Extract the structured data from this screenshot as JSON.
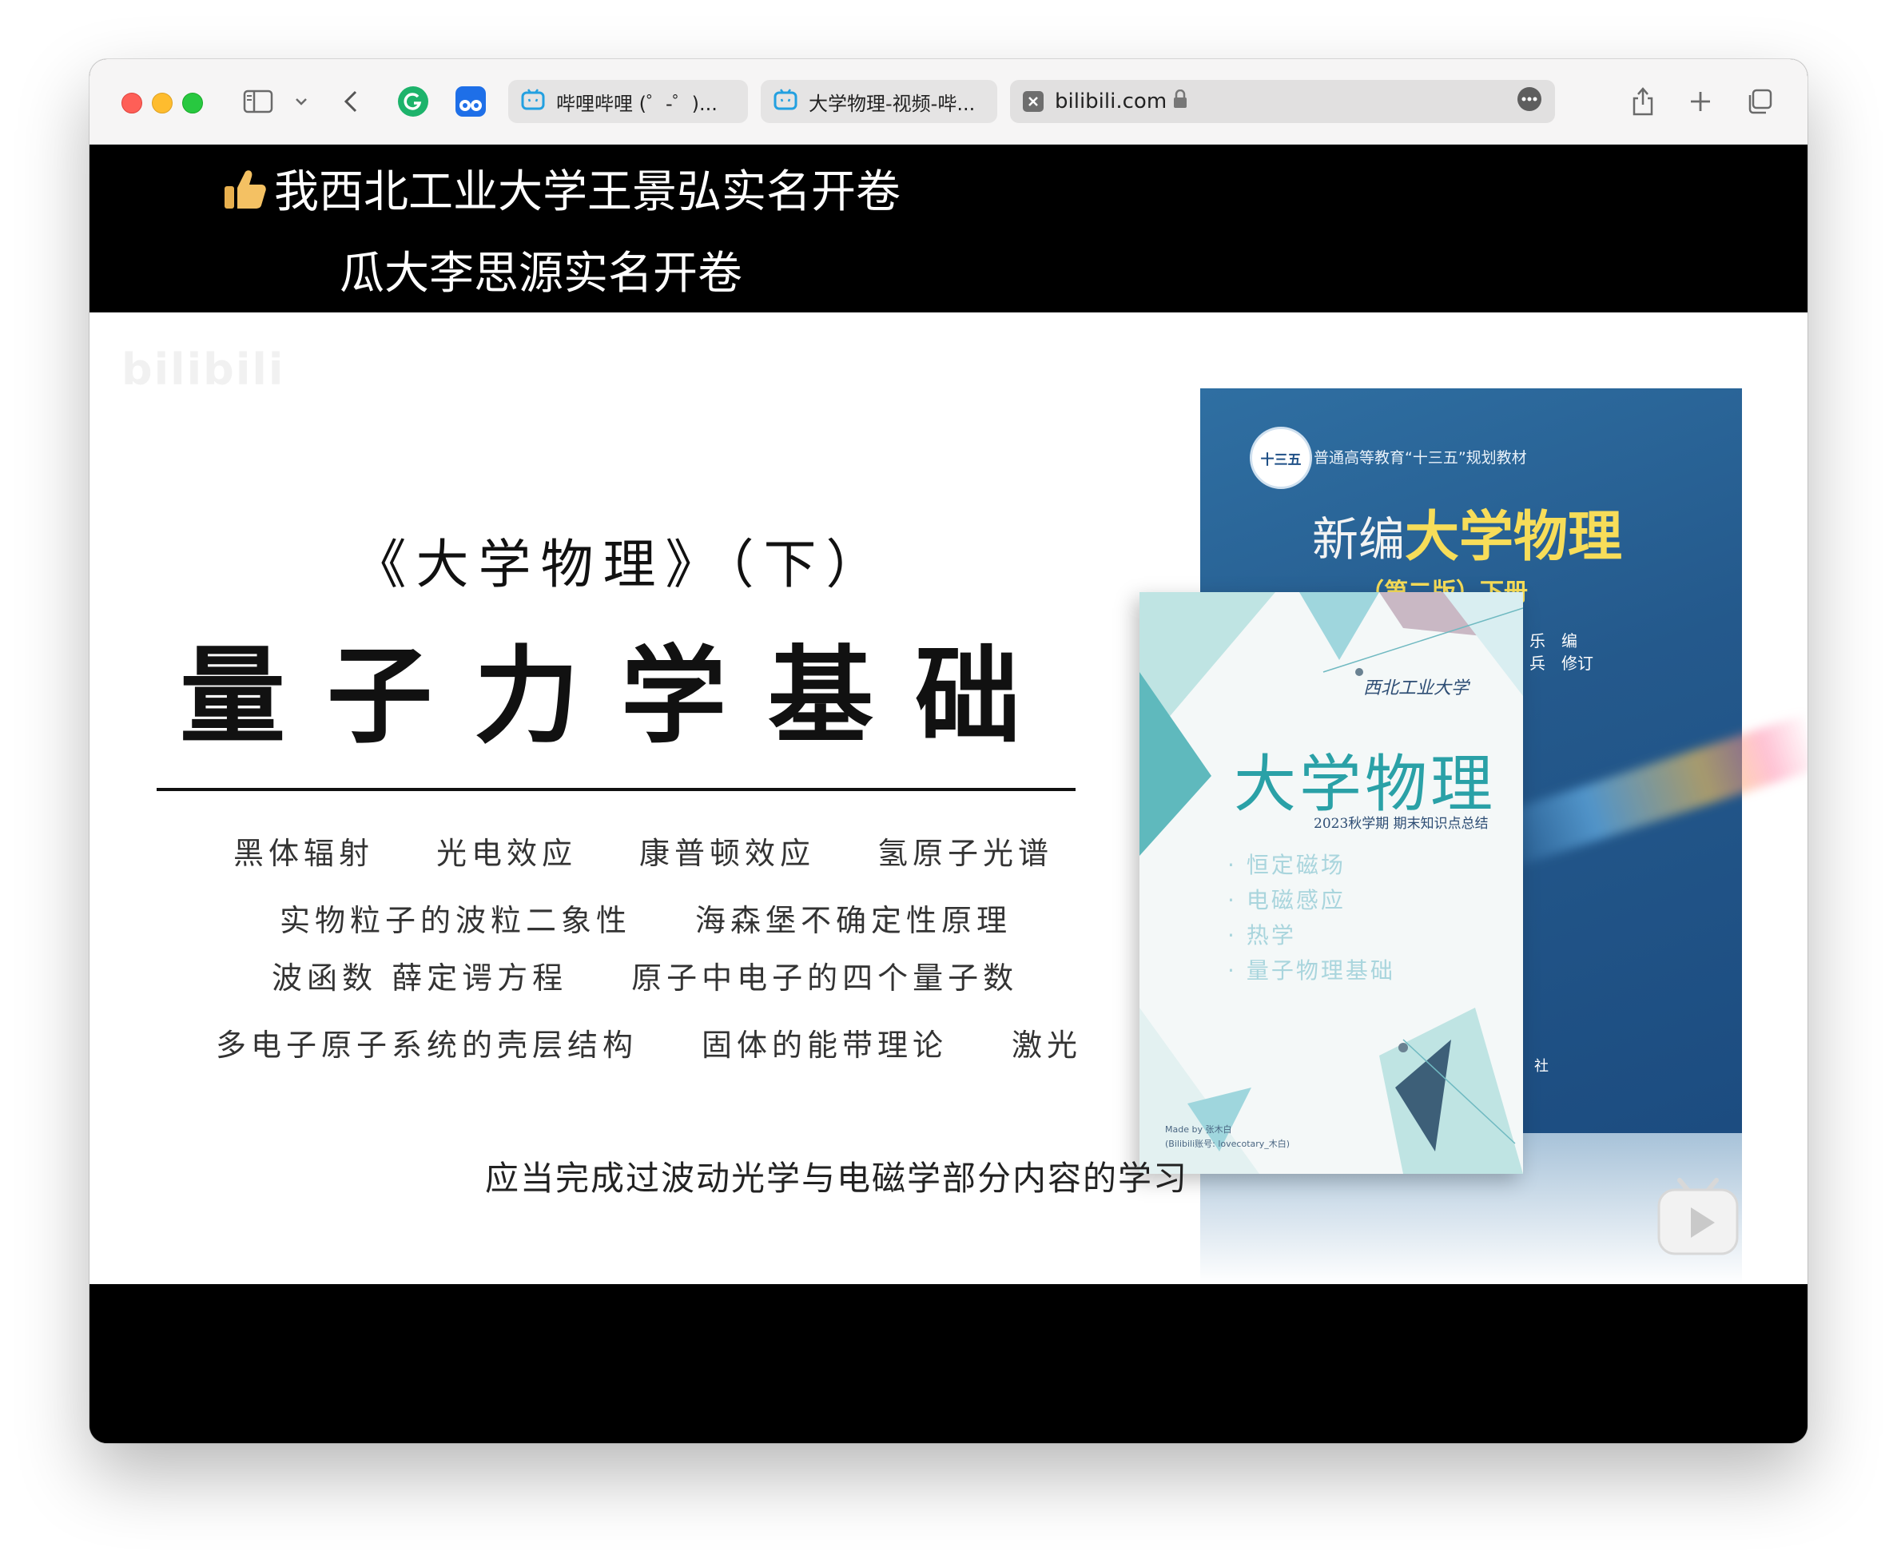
{
  "browser": {
    "tabs": [
      {
        "label": "哔哩哔哩 (゜-゜)...",
        "icon": "bilibili-tv-icon"
      },
      {
        "label": "大学物理-视频-哔...",
        "icon": "bilibili-tv-icon"
      }
    ],
    "address": "bilibili.com",
    "colors": {
      "close": "#fe5f57",
      "minimize": "#febc2e",
      "maximize": "#28c840",
      "extension_green": "#1db36b",
      "extension_blue": "#1e6fe8"
    }
  },
  "danmaku": [
    "我西北工业大学王景弘实名开卷",
    "瓜大李思源实名开卷"
  ],
  "slide": {
    "book_title": "《大学物理》（下）",
    "main_title": "量子力学基础",
    "topics": [
      [
        "黑体辐射",
        "光电效应",
        "康普顿效应",
        "氢原子光谱"
      ],
      [
        "实物粒子的波粒二象性",
        "海森堡不确定性原理"
      ],
      [
        "波函数 薛定谔方程",
        "原子中电子的四个量子数"
      ],
      [
        "多电子原子系统的壳层结构",
        "固体的能带理论",
        "激光"
      ]
    ],
    "prerequisite": "应当完成过波动光学与电磁学部分内容的学习",
    "watermark": "bilibili"
  },
  "cover_blue": {
    "series": "普通高等教育“十三五”规划教材",
    "badge": "十三五",
    "title_prefix": "新编",
    "title": "大学物理",
    "edition": "（第二版）下册",
    "credit_1": "乐　编",
    "credit_2": "兵　修订",
    "publisher_fragment": "社"
  },
  "cover_light": {
    "university": "西北工业大学",
    "title": "大学物理",
    "subtitle": "2023秋学期 期末知识点总结",
    "items": [
      "恒定磁场",
      "电磁感应",
      "热学",
      "量子物理基础"
    ],
    "credit_1": "Made by 张木白",
    "credit_2": "(Bilibili账号: lovecotary_木白)"
  }
}
